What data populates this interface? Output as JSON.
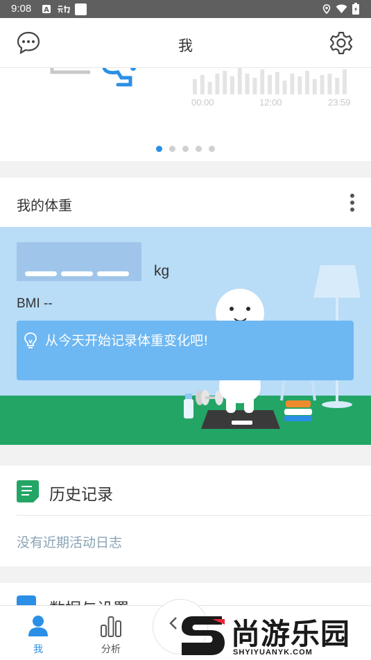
{
  "status_bar": {
    "time": "9:08",
    "icons": [
      "a-badge-icon",
      "dong-icon",
      "square-icon",
      "location-icon",
      "wifi-icon",
      "battery-icon"
    ]
  },
  "header": {
    "title": "我",
    "left_icon": "message-icon",
    "right_icon": "gear-icon"
  },
  "carousel": {
    "ticks": [
      "00:00",
      "12:00",
      "23:59"
    ],
    "dots": 5,
    "active_dot": 0
  },
  "weight_card": {
    "title": "我的体重",
    "unit": "kg",
    "bmi": "BMI --",
    "tip": "从今天开始记录体重变化吧!"
  },
  "history_card": {
    "title": "历史记录",
    "empty_text": "没有近期活动日志"
  },
  "settings_card": {
    "title": "数据与设置"
  },
  "tabs": [
    {
      "label": "我",
      "icon": "person-icon",
      "active": true
    },
    {
      "label": "分析",
      "icon": "bar-chart-icon",
      "active": false
    }
  ],
  "watermark": {
    "text": "尚游乐园",
    "sub": "SHYIYUANYK.COM"
  },
  "colors": {
    "accent": "#2b8fe6",
    "ground": "#23a565",
    "sky": "#b9dcf7",
    "tip": "#6db7f2"
  }
}
